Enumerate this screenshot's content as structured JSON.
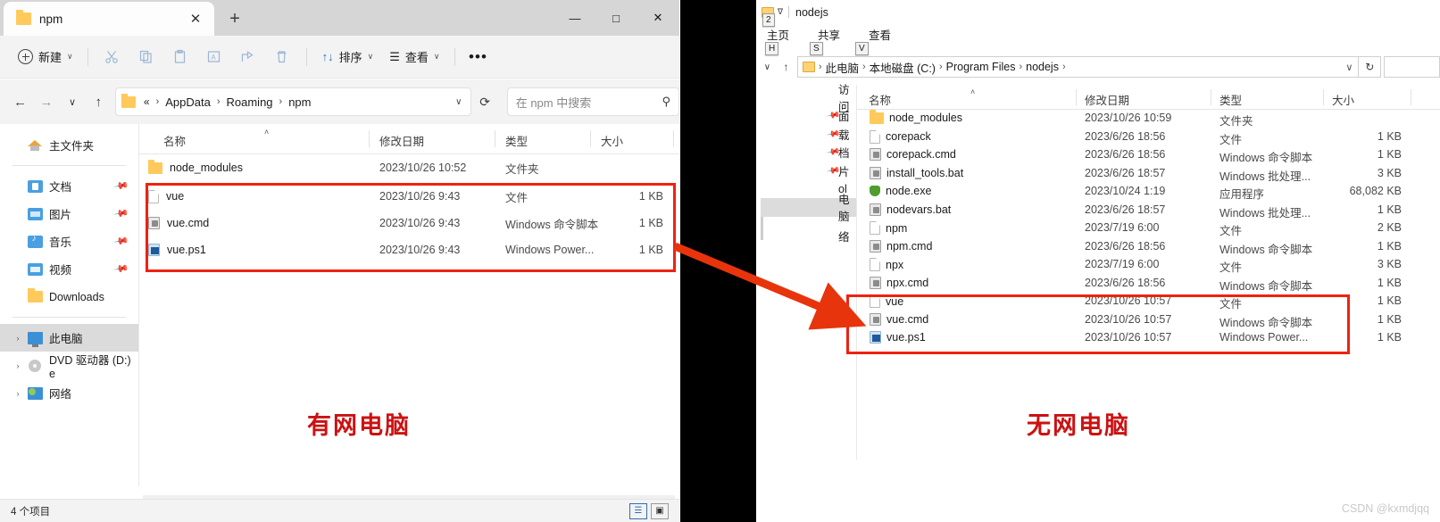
{
  "left_window": {
    "tab": {
      "title": "npm",
      "close_label": "✕",
      "new_tab_label": "+"
    },
    "window_controls": {
      "minimize": "—",
      "maximize": "□",
      "close": "✕"
    },
    "toolbar": {
      "new_label": "新建",
      "chevron": "∨",
      "cut_icon": "scissors-icon",
      "copy_icon": "copy-icon",
      "paste_icon": "paste-icon",
      "rename_icon": "rename-icon",
      "share_icon": "share-icon",
      "delete_icon": "trash-icon",
      "sort_label": "排序",
      "sort_icon": "↑↓",
      "view_label": "查看",
      "view_icon": "☰",
      "more_label": "•••"
    },
    "address": {
      "back": "←",
      "forward": "→",
      "recent": "∨",
      "up": "↑",
      "crumbs": [
        "«",
        "AppData",
        "Roaming",
        "npm"
      ],
      "separator": "›",
      "dropdown": "∨",
      "refresh": "⟳"
    },
    "search": {
      "placeholder": "在 npm 中搜索",
      "icon": "⚲"
    },
    "sidebar": {
      "home": {
        "label": "主文件夹",
        "icon": "home-icon"
      },
      "items": [
        {
          "label": "文档",
          "icon": "documents-icon",
          "pinned": true
        },
        {
          "label": "图片",
          "icon": "pictures-icon",
          "pinned": true
        },
        {
          "label": "音乐",
          "icon": "music-icon",
          "pinned": true
        },
        {
          "label": "视频",
          "icon": "videos-icon",
          "pinned": true
        },
        {
          "label": "Downloads",
          "icon": "folder-icon",
          "pinned": false
        }
      ],
      "tree": [
        {
          "label": "此电脑",
          "icon": "pc-icon",
          "selected": true,
          "arrow": "›"
        },
        {
          "label": "DVD 驱动器 (D:) e",
          "icon": "dvd-icon",
          "selected": false,
          "arrow": "›"
        },
        {
          "label": "网络",
          "icon": "network-icon",
          "selected": false,
          "arrow": "›"
        }
      ]
    },
    "columns": {
      "name": "名称",
      "date": "修改日期",
      "type": "类型",
      "size": "大小",
      "sort_caret": "˄"
    },
    "files": [
      {
        "name": "node_modules",
        "date": "2023/10/26 10:52",
        "type": "文件夹",
        "size": "",
        "icon": "folder-icon"
      },
      {
        "name": "vue",
        "date": "2023/10/26 9:43",
        "type": "文件",
        "size": "1 KB",
        "icon": "blank-file-icon"
      },
      {
        "name": "vue.cmd",
        "date": "2023/10/26 9:43",
        "type": "Windows 命令脚本",
        "size": "1 KB",
        "icon": "cmd-script-icon"
      },
      {
        "name": "vue.ps1",
        "date": "2023/10/26 9:43",
        "type": "Windows Power...",
        "size": "1 KB",
        "icon": "powershell-icon"
      }
    ],
    "status": {
      "count": "4 个项目",
      "details_view": "☰",
      "tiles_view": "▣"
    }
  },
  "right_window": {
    "title": "nodejs",
    "quick_access": {
      "folder_icon": "folder-icon",
      "chevron": "∇"
    },
    "ribbon_tabs": [
      {
        "label": "主页",
        "keytip": "H"
      },
      {
        "label": "共享",
        "keytip": "S"
      },
      {
        "label": "查看",
        "keytip": "V"
      }
    ],
    "quick_access_keytip": "2",
    "address": {
      "recent": "∨",
      "up": "↑",
      "crumbs": [
        "此电脑",
        "本地磁盘 (C:)",
        "Program Files",
        "nodejs"
      ],
      "separator": "›",
      "dropdown": "∨",
      "refresh": "↻"
    },
    "sidebar": [
      {
        "label": "访问",
        "pinned": false,
        "selected": false
      },
      {
        "label": "面",
        "pinned": true,
        "selected": false
      },
      {
        "label": "载",
        "pinned": true,
        "selected": false
      },
      {
        "label": "档",
        "pinned": true,
        "selected": false
      },
      {
        "label": "片",
        "pinned": true,
        "selected": false
      },
      {
        "label": "ol",
        "pinned": false,
        "selected": false
      },
      {
        "label": "电脑",
        "pinned": false,
        "selected": true
      },
      {
        "label": "络",
        "pinned": false,
        "selected": false
      }
    ],
    "columns": {
      "name": "名称",
      "date": "修改日期",
      "type": "类型",
      "size": "大小",
      "sort_caret": "˄"
    },
    "files": [
      {
        "name": "node_modules",
        "date": "2023/10/26 10:59",
        "type": "文件夹",
        "size": "",
        "icon": "folder-icon"
      },
      {
        "name": "corepack",
        "date": "2023/6/26 18:56",
        "type": "文件",
        "size": "1 KB",
        "icon": "blank-file-icon"
      },
      {
        "name": "corepack.cmd",
        "date": "2023/6/26 18:56",
        "type": "Windows 命令脚本",
        "size": "1 KB",
        "icon": "cmd-script-icon"
      },
      {
        "name": "install_tools.bat",
        "date": "2023/6/26 18:57",
        "type": "Windows 批处理...",
        "size": "3 KB",
        "icon": "bat-script-icon"
      },
      {
        "name": "node.exe",
        "date": "2023/10/24 1:19",
        "type": "应用程序",
        "size": "68,082 KB",
        "icon": "nodejs-exe-icon"
      },
      {
        "name": "nodevars.bat",
        "date": "2023/6/26 18:57",
        "type": "Windows 批处理...",
        "size": "1 KB",
        "icon": "bat-script-icon"
      },
      {
        "name": "npm",
        "date": "2023/7/19 6:00",
        "type": "文件",
        "size": "2 KB",
        "icon": "blank-file-icon"
      },
      {
        "name": "npm.cmd",
        "date": "2023/6/26 18:56",
        "type": "Windows 命令脚本",
        "size": "1 KB",
        "icon": "cmd-script-icon"
      },
      {
        "name": "npx",
        "date": "2023/7/19 6:00",
        "type": "文件",
        "size": "3 KB",
        "icon": "blank-file-icon"
      },
      {
        "name": "npx.cmd",
        "date": "2023/6/26 18:56",
        "type": "Windows 命令脚本",
        "size": "1 KB",
        "icon": "cmd-script-icon"
      },
      {
        "name": "vue",
        "date": "2023/10/26 10:57",
        "type": "文件",
        "size": "1 KB",
        "icon": "blank-file-icon"
      },
      {
        "name": "vue.cmd",
        "date": "2023/10/26 10:57",
        "type": "Windows 命令脚本",
        "size": "1 KB",
        "icon": "cmd-script-icon"
      },
      {
        "name": "vue.ps1",
        "date": "2023/10/26 10:57",
        "type": "Windows Power...",
        "size": "1 KB",
        "icon": "powershell-icon"
      }
    ]
  },
  "annotations": {
    "left_caption": "有网电脑",
    "right_caption": "无网电脑",
    "highlight_color": "#ee2211",
    "caption_color": "#cc1111"
  },
  "watermark": "CSDN @kxmdjqq"
}
